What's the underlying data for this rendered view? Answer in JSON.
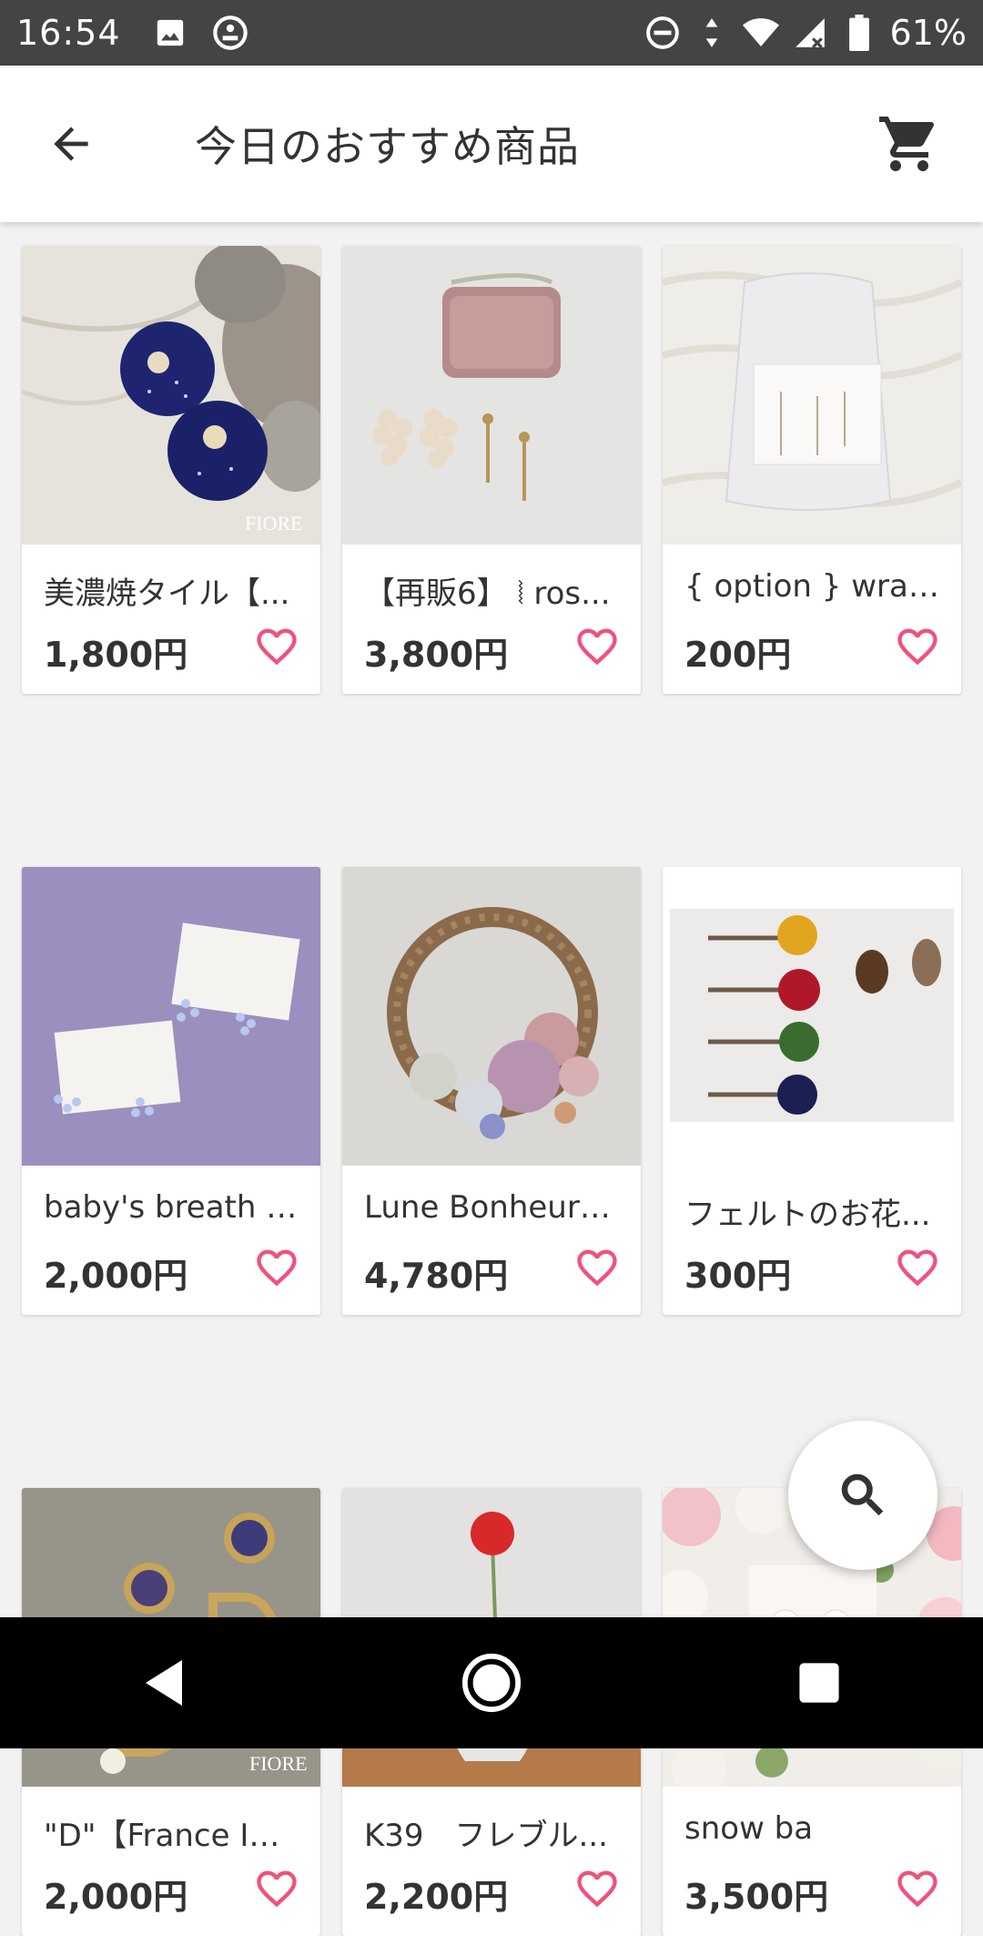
{
  "status_bar": {
    "time": "16:54",
    "battery": "61%",
    "icons": [
      "image-icon",
      "download-icon",
      "do-not-disturb-icon",
      "data-arrows-icon",
      "wifi-icon",
      "signal-icon",
      "battery-icon"
    ]
  },
  "app_bar": {
    "title": "今日のおすすめ商品",
    "back_icon": "arrow-back-icon",
    "cart_icon": "cart-icon"
  },
  "products": [
    {
      "name": "美濃焼タイル【...",
      "price": "1,800円"
    },
    {
      "name": "【再販6】 ⦚ ros...",
      "price": "3,800円"
    },
    {
      "name": "{ option } wrap...",
      "price": "200円"
    },
    {
      "name": "baby's breath pi...",
      "price": "2,000円"
    },
    {
      "name": "Lune Bonheur L...",
      "price": "4,780円"
    },
    {
      "name": "フェルトのお花...",
      "price": "300円"
    },
    {
      "name": "\"D\"【France Im...",
      "price": "2,000円"
    },
    {
      "name": "K39　フレブル...",
      "price": "2,200円"
    },
    {
      "name": "snow ba",
      "price": "3,500円"
    }
  ],
  "watermarks": {
    "fiore": "FIORE"
  },
  "colors": {
    "heart": "#f0527a",
    "app_bar": "#ffffff",
    "status_bar": "#444444"
  }
}
